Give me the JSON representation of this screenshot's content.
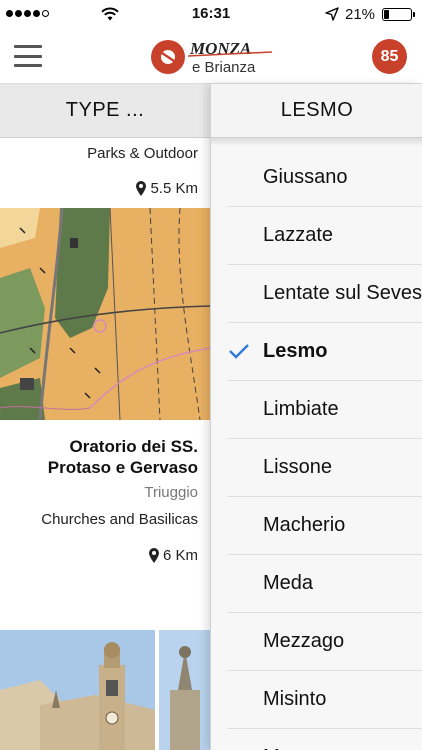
{
  "status_bar": {
    "time": "16:31",
    "battery_percent_label": "21%",
    "battery_level": 0.21,
    "signal_bars_filled": 4,
    "signal_bars_total": 5
  },
  "nav": {
    "logo_line1": "MONZA",
    "logo_line2": "e Brianza",
    "notification_count": "85",
    "badge_color": "#c8412b"
  },
  "filters": {
    "type_label": "TYPE ...",
    "town_label": "LESMO"
  },
  "cards": [
    {
      "category": "Parks & Outdoor",
      "distance": "5.5 Km"
    },
    {
      "title": "Oratorio dei SS. Protaso e Gervaso",
      "town": "Triuggio",
      "category": "Churches and Basilicas",
      "distance": "6 Km"
    }
  ],
  "towns": [
    {
      "label": "Giussano",
      "selected": false
    },
    {
      "label": "Lazzate",
      "selected": false
    },
    {
      "label": "Lentate sul Seveso",
      "selected": false
    },
    {
      "label": "Lesmo",
      "selected": true
    },
    {
      "label": "Limbiate",
      "selected": false
    },
    {
      "label": "Lissone",
      "selected": false
    },
    {
      "label": "Macherio",
      "selected": false
    },
    {
      "label": "Meda",
      "selected": false
    },
    {
      "label": "Mezzago",
      "selected": false
    },
    {
      "label": "Misinto",
      "selected": false
    },
    {
      "label": "Monza",
      "selected": false
    }
  ],
  "colors": {
    "accent": "#2f7bd8",
    "map_fill": "#e8b062",
    "map_forest": "#5e7a4b"
  }
}
